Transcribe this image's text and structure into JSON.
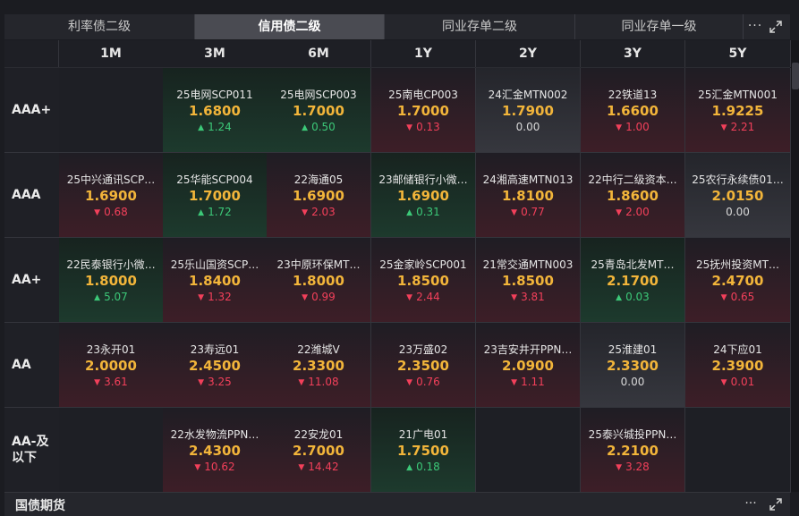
{
  "tabs": [
    "利率债二级",
    "信用债二级",
    "同业存单二级",
    "同业存单一级"
  ],
  "active_tab_index": 1,
  "toolbar": {
    "more_label": "···"
  },
  "tenors": [
    "1M",
    "3M",
    "6M",
    "1Y",
    "2Y",
    "3Y",
    "5Y"
  ],
  "rows": [
    {
      "rating": "AAA+",
      "cells": [
        null,
        {
          "bond": "25电网SCP011",
          "rate": "1.6800",
          "change": "1.24",
          "dir": "up"
        },
        {
          "bond": "25电网SCP003",
          "rate": "1.7000",
          "change": "0.50",
          "dir": "up"
        },
        {
          "bond": "25南电CP003",
          "rate": "1.7000",
          "change": "0.13",
          "dir": "down"
        },
        {
          "bond": "24汇金MTN002",
          "rate": "1.7900",
          "change": "0.00",
          "dir": "flat"
        },
        {
          "bond": "22铁道13",
          "rate": "1.6600",
          "change": "1.00",
          "dir": "down"
        },
        {
          "bond": "25汇金MTN001",
          "rate": "1.9225",
          "change": "2.21",
          "dir": "down"
        }
      ]
    },
    {
      "rating": "AAA",
      "cells": [
        {
          "bond": "25中兴通讯SCP…",
          "rate": "1.6900",
          "change": "0.68",
          "dir": "down"
        },
        {
          "bond": "25华能SCP004",
          "rate": "1.7000",
          "change": "1.72",
          "dir": "up"
        },
        {
          "bond": "22海通05",
          "rate": "1.6900",
          "change": "2.03",
          "dir": "down"
        },
        {
          "bond": "23邮储银行小微…",
          "rate": "1.6900",
          "change": "0.31",
          "dir": "up"
        },
        {
          "bond": "24湘高速MTN013",
          "rate": "1.8100",
          "change": "0.77",
          "dir": "down"
        },
        {
          "bond": "22中行二级资本…",
          "rate": "1.8600",
          "change": "2.00",
          "dir": "down"
        },
        {
          "bond": "25农行永续债01…",
          "rate": "2.0150",
          "change": "0.00",
          "dir": "flat"
        }
      ]
    },
    {
      "rating": "AA+",
      "cells": [
        {
          "bond": "22民泰银行小微…",
          "rate": "1.8000",
          "change": "5.07",
          "dir": "up"
        },
        {
          "bond": "25乐山国资SCP…",
          "rate": "1.8400",
          "change": "1.32",
          "dir": "down"
        },
        {
          "bond": "23中原环保MT…",
          "rate": "1.8000",
          "change": "0.99",
          "dir": "down"
        },
        {
          "bond": "25金家岭SCP001",
          "rate": "1.8500",
          "change": "2.44",
          "dir": "down"
        },
        {
          "bond": "21常交通MTN003",
          "rate": "1.8500",
          "change": "3.81",
          "dir": "down"
        },
        {
          "bond": "25青岛北发MT…",
          "rate": "2.1700",
          "change": "0.03",
          "dir": "up"
        },
        {
          "bond": "25抚州投资MT…",
          "rate": "2.4700",
          "change": "0.65",
          "dir": "down"
        }
      ]
    },
    {
      "rating": "AA",
      "cells": [
        {
          "bond": "23永开01",
          "rate": "2.0000",
          "change": "3.61",
          "dir": "down"
        },
        {
          "bond": "23寿远01",
          "rate": "2.4500",
          "change": "3.25",
          "dir": "down"
        },
        {
          "bond": "22潍城V",
          "rate": "2.3300",
          "change": "11.08",
          "dir": "down"
        },
        {
          "bond": "23万盛02",
          "rate": "2.3500",
          "change": "0.76",
          "dir": "down"
        },
        {
          "bond": "23吉安井开PPN…",
          "rate": "2.0900",
          "change": "1.11",
          "dir": "down"
        },
        {
          "bond": "25淮建01",
          "rate": "2.3300",
          "change": "0.00",
          "dir": "flat"
        },
        {
          "bond": "24下应01",
          "rate": "2.3900",
          "change": "0.01",
          "dir": "down"
        }
      ]
    },
    {
      "rating": "AA-及以下",
      "cells": [
        null,
        {
          "bond": "22水发物流PPN…",
          "rate": "2.4300",
          "change": "10.62",
          "dir": "down"
        },
        {
          "bond": "22安龙01",
          "rate": "2.7000",
          "change": "14.42",
          "dir": "down"
        },
        {
          "bond": "21广电01",
          "rate": "1.7500",
          "change": "0.18",
          "dir": "up"
        },
        null,
        {
          "bond": "25泰兴城投PPN…",
          "rate": "2.2100",
          "change": "3.28",
          "dir": "down"
        },
        null
      ]
    }
  ],
  "footer": {
    "title": "国债期货",
    "more_label": "···"
  },
  "colors": {
    "rate": "#f2b53a",
    "up": "#3cc878",
    "down": "#f2405a",
    "flat": "#d8d8d8"
  },
  "icons": {
    "more": "more-dots-icon",
    "expand": "expand-icon",
    "up": "triangle-up-icon",
    "down": "triangle-down-icon"
  }
}
